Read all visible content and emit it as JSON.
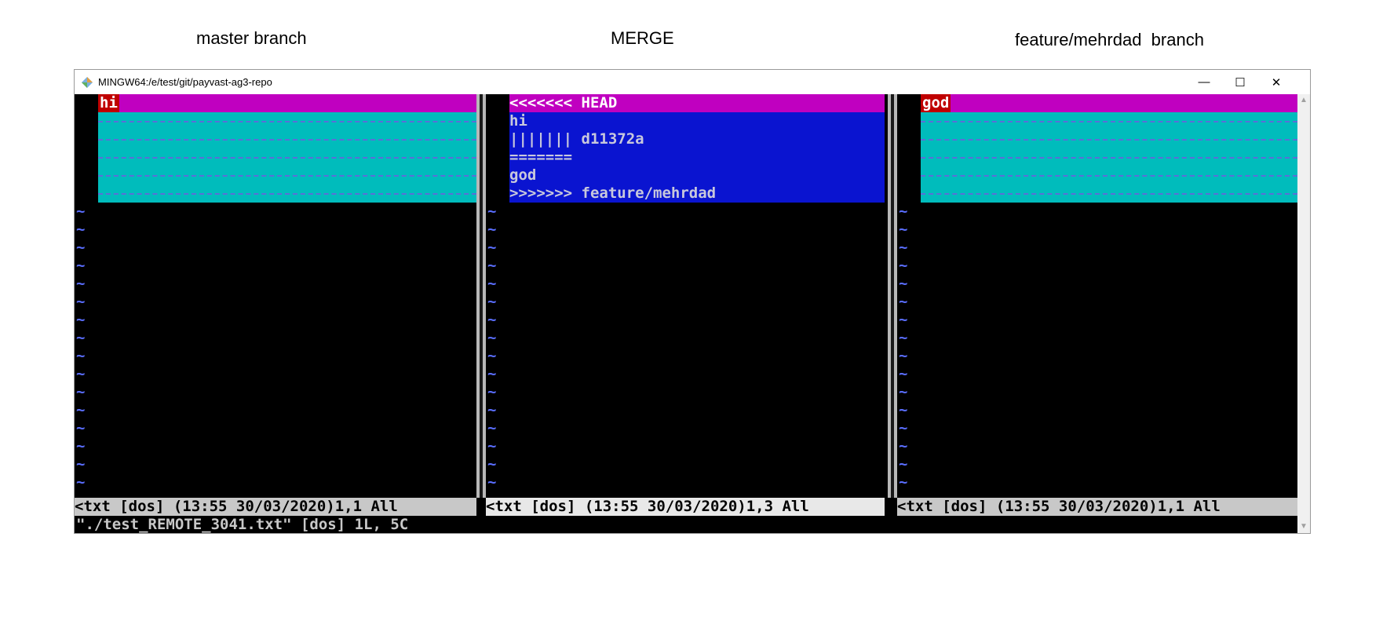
{
  "captions": {
    "left": "master branch",
    "middle": "MERGE",
    "right": "feature/mehrdad  branch"
  },
  "window": {
    "title": "MINGW64:/e/test/git/payvast-ag3-repo",
    "minimize": "—",
    "maximize": "☐",
    "close": "✕"
  },
  "panes": {
    "left": {
      "first_line": "hi",
      "status": "<txt [dos] (13:55 30/03/2020)1,1 All"
    },
    "middle": {
      "lines": [
        "<<<<<<< HEAD",
        "hi",
        "||||||| d11372a",
        "=======",
        "god",
        ">>>>>>> feature/mehrdad"
      ],
      "status": "<txt [dos] (13:55 30/03/2020)1,3 All"
    },
    "right": {
      "first_line": "god",
      "status": "<txt [dos] (13:55 30/03/2020)1,1 All"
    }
  },
  "tilde": "~",
  "command_line": "\"./test_REMOTE_3041.txt\" [dos] 1L, 5C",
  "colors": {
    "magenta": "#c000c0",
    "red": "#c00000",
    "cyan": "#00bcbc",
    "blue": "#0a14d0",
    "tilde": "#5a6eff"
  }
}
